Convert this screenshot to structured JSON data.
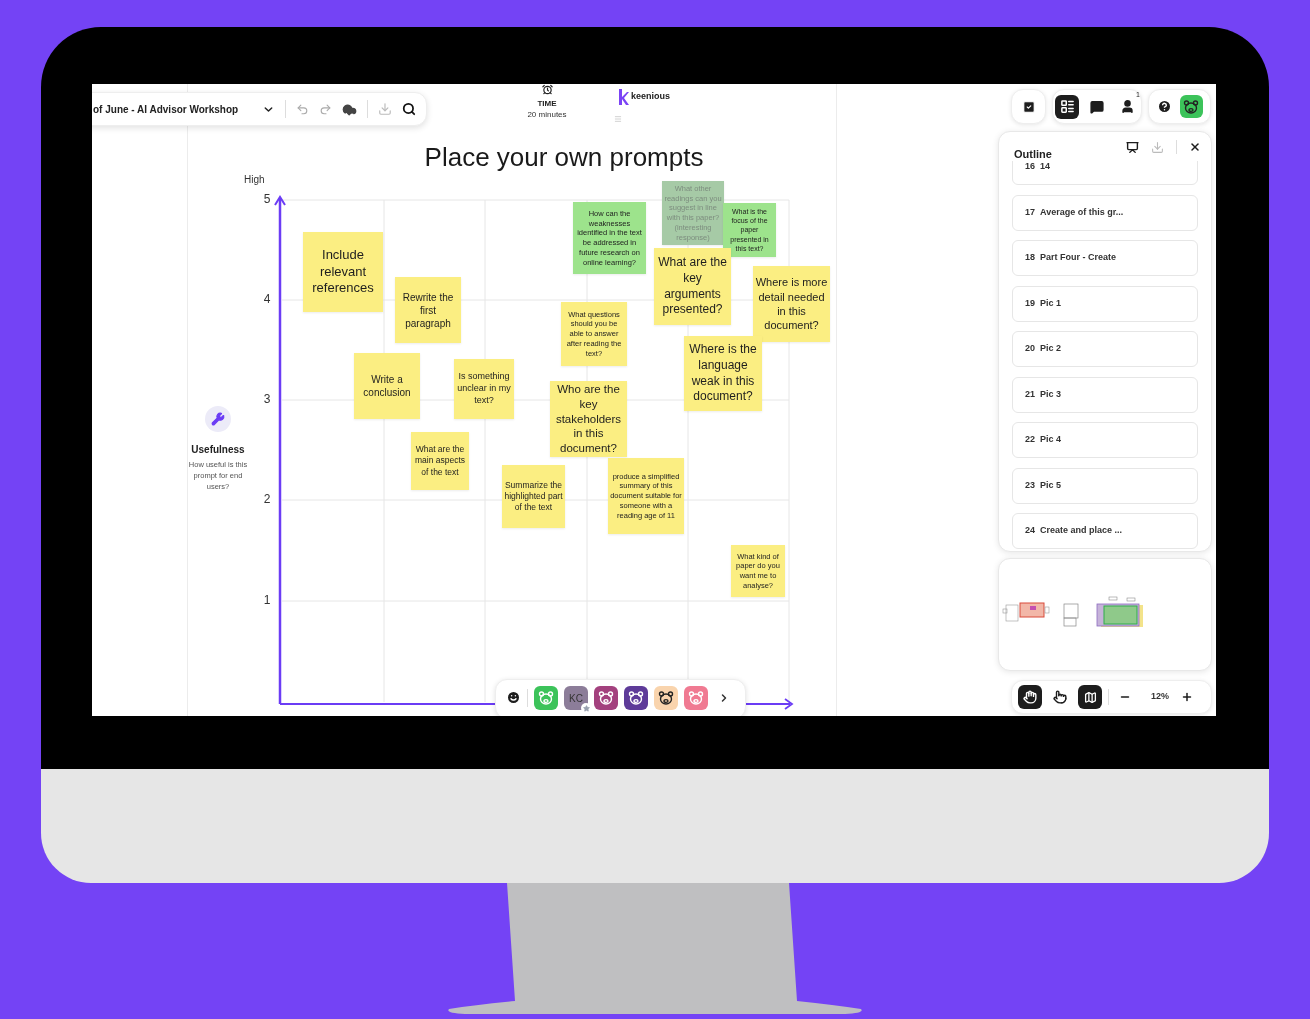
{
  "toolbar": {
    "board_title": "of June - AI Advisor Workshop"
  },
  "timer": {
    "label": "TIME",
    "value": "20 minutes"
  },
  "logo": {
    "text": "keenious"
  },
  "board": {
    "title": "Place your own prompts",
    "axis_top_label": "High",
    "y_ticks": [
      "5",
      "4",
      "3",
      "2",
      "1"
    ],
    "criterion": {
      "name": "Usefulness",
      "description": "How useful is this prompt for end users?"
    }
  },
  "notes": [
    {
      "text": "How can the weaknesses identified in the text be addressed in future research on online learning?",
      "color": "#9de38c",
      "dimmed": false
    },
    {
      "text": "What other readings can you suggest in line with this paper? (interesting response)",
      "color": "#a6caa6",
      "dimmed": true
    },
    {
      "text": "What is the focus of the paper presented in this text?",
      "color": "#9de38c",
      "dimmed": false
    },
    {
      "text": "Include relevant references",
      "color": "#fbee82",
      "dimmed": false
    },
    {
      "text": "Rewrite the first paragraph",
      "color": "#fbee82",
      "dimmed": false
    },
    {
      "text": "What questions should you be able to answer after reading the text?",
      "color": "#fbee82",
      "dimmed": false
    },
    {
      "text": "What are the key arguments presented?",
      "color": "#fbee82",
      "dimmed": false
    },
    {
      "text": "Where is more detail needed in this document?",
      "color": "#fbee82",
      "dimmed": false
    },
    {
      "text": "Write a conclusion",
      "color": "#fbee82",
      "dimmed": false
    },
    {
      "text": "What are the main aspects of the text",
      "color": "#fbee82",
      "dimmed": false
    },
    {
      "text": "Is something unclear in my text?",
      "color": "#fbee82",
      "dimmed": false
    },
    {
      "text": "Who are the key stakeholders in this document?",
      "color": "#fbee82",
      "dimmed": false
    },
    {
      "text": "Where is the language weak in this document?",
      "color": "#fbee82",
      "dimmed": false
    },
    {
      "text": "Summarize the highlighted part of the text",
      "color": "#fbee82",
      "dimmed": false
    },
    {
      "text": "produce a simplified summary of this document suitable for someone with a reading  age of 11",
      "color": "#fbee82",
      "dimmed": false
    },
    {
      "text": "What kind of paper do you want me to analyse?",
      "color": "#fbee82",
      "dimmed": false
    }
  ],
  "participants": [
    {
      "kind": "animal",
      "color": "#3cc35a",
      "host": false
    },
    {
      "kind": "initials",
      "initials": "KC",
      "color": "#8c7d99",
      "host": true
    },
    {
      "kind": "animal",
      "color": "#a3417e",
      "host": false
    },
    {
      "kind": "animal",
      "color": "#5e3b99",
      "host": false
    },
    {
      "kind": "animal",
      "color": "#f9d4ad",
      "host": false
    },
    {
      "kind": "animal",
      "color": "#f07a92",
      "host": false
    }
  ],
  "panels": [
    {
      "kind": "outline",
      "selected": true
    },
    {
      "kind": "chat",
      "selected": false
    },
    {
      "kind": "people",
      "selected": false,
      "badge": "1"
    }
  ],
  "outline": {
    "title": "Outline",
    "items": [
      {
        "number": "16",
        "title": "14"
      },
      {
        "number": "17",
        "title": "Average of this gr..."
      },
      {
        "number": "18",
        "title": "Part Four - Create"
      },
      {
        "number": "19",
        "title": "Pic 1"
      },
      {
        "number": "20",
        "title": "Pic 2"
      },
      {
        "number": "21",
        "title": "Pic 3"
      },
      {
        "number": "22",
        "title": "Pic 4"
      },
      {
        "number": "23",
        "title": "Pic 5"
      },
      {
        "number": "24",
        "title": "Create and place ..."
      }
    ]
  },
  "tools": [
    {
      "kind": "hand",
      "selected": true
    },
    {
      "kind": "pointer",
      "selected": false
    }
  ],
  "minimap_on": true,
  "zoom": {
    "level_text": "12%"
  }
}
